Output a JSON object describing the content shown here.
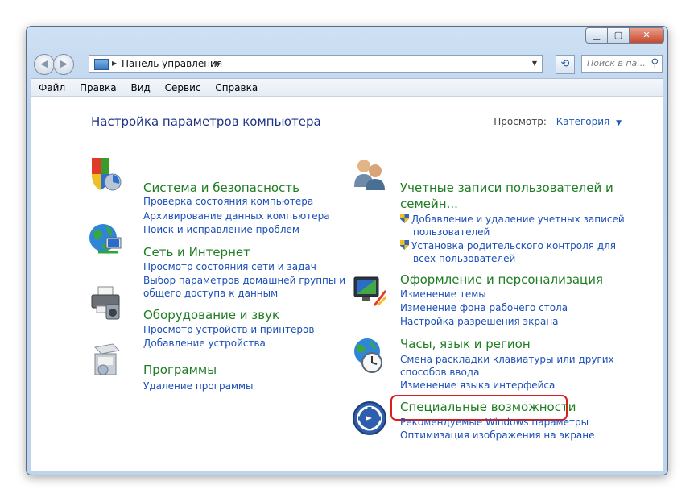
{
  "addressbar": {
    "path": "Панель управления"
  },
  "search": {
    "placeholder": "Поиск в па..."
  },
  "menu": [
    "Файл",
    "Правка",
    "Вид",
    "Сервис",
    "Справка"
  ],
  "heading": "Настройка параметров компьютера",
  "view": {
    "label": "Просмотр:",
    "value": "Категория"
  },
  "left": [
    {
      "title": "Система и безопасность",
      "icon": "security-shield-icon",
      "links": [
        "Проверка состояния компьютера",
        "Архивирование данных компьютера",
        "Поиск и исправление проблем"
      ]
    },
    {
      "title": "Сеть и Интернет",
      "icon": "network-globe-icon",
      "links": [
        "Просмотр состояния сети и задач",
        "Выбор параметров домашней группы и",
        "общего доступа к данным"
      ]
    },
    {
      "title": "Оборудование и звук",
      "icon": "printer-hardware-icon",
      "links": [
        "Просмотр устройств и принтеров",
        "Добавление устройства"
      ]
    },
    {
      "title": "Программы",
      "icon": "programs-box-icon",
      "links": [
        "Удаление программы"
      ]
    }
  ],
  "right": [
    {
      "title_line1": "Учетные записи пользователей и",
      "title_line2": "семейн...",
      "icon": "users-icon",
      "links": [
        "Добавление и удаление учетных записей",
        "пользователей",
        "Установка родительского контроля для",
        "всех пользователей"
      ]
    },
    {
      "title": "Оформление и персонализация",
      "icon": "appearance-monitor-icon",
      "links": [
        "Изменение темы",
        "Изменение фона рабочего стола",
        "Настройка разрешения экрана"
      ]
    },
    {
      "title": "Часы, язык и регион",
      "icon": "clock-globe-icon",
      "links": [
        "Смена раскладки клавиатуры или других",
        "способов ввода",
        "Изменение языка интерфейса"
      ]
    },
    {
      "title": "Специальные возможности",
      "icon": "accessibility-icon",
      "links": [
        "Рекомендуемые Windows параметры",
        "Оптимизация изображения на экране"
      ]
    }
  ],
  "colors": {
    "category_title": "#1e7d22",
    "link": "#1b4fb8",
    "heading": "#1e3287",
    "highlight": "#d82020"
  }
}
